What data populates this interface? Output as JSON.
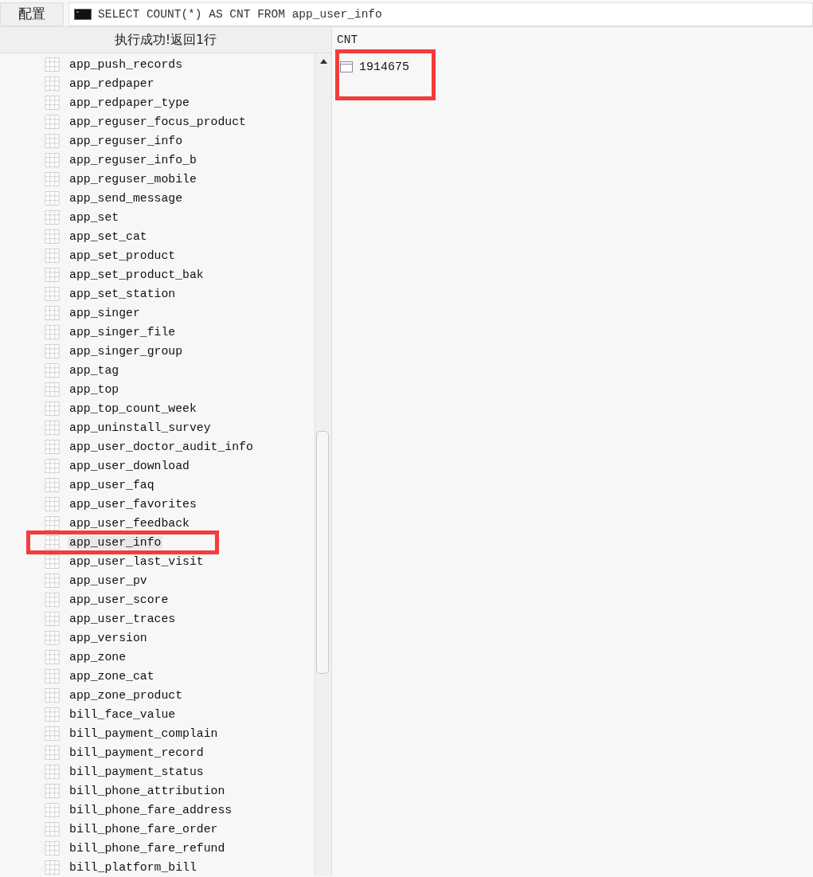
{
  "toolbar": {
    "config_label": "配置",
    "query": "SELECT COUNT(*) AS CNT FROM app_user_info"
  },
  "status": "执行成功!返回1行",
  "tables": [
    {
      "name": "app_push_records",
      "selected": false,
      "highlighted": false
    },
    {
      "name": "app_redpaper",
      "selected": false,
      "highlighted": false
    },
    {
      "name": "app_redpaper_type",
      "selected": false,
      "highlighted": false
    },
    {
      "name": "app_reguser_focus_product",
      "selected": false,
      "highlighted": false
    },
    {
      "name": "app_reguser_info",
      "selected": false,
      "highlighted": false
    },
    {
      "name": "app_reguser_info_b",
      "selected": false,
      "highlighted": false
    },
    {
      "name": "app_reguser_mobile",
      "selected": false,
      "highlighted": false
    },
    {
      "name": "app_send_message",
      "selected": false,
      "highlighted": false
    },
    {
      "name": "app_set",
      "selected": false,
      "highlighted": false
    },
    {
      "name": "app_set_cat",
      "selected": false,
      "highlighted": false
    },
    {
      "name": "app_set_product",
      "selected": false,
      "highlighted": false
    },
    {
      "name": "app_set_product_bak",
      "selected": false,
      "highlighted": false
    },
    {
      "name": "app_set_station",
      "selected": false,
      "highlighted": false
    },
    {
      "name": "app_singer",
      "selected": false,
      "highlighted": false
    },
    {
      "name": "app_singer_file",
      "selected": false,
      "highlighted": false
    },
    {
      "name": "app_singer_group",
      "selected": false,
      "highlighted": false
    },
    {
      "name": "app_tag",
      "selected": false,
      "highlighted": false
    },
    {
      "name": "app_top",
      "selected": false,
      "highlighted": false
    },
    {
      "name": "app_top_count_week",
      "selected": false,
      "highlighted": false
    },
    {
      "name": "app_uninstall_survey",
      "selected": false,
      "highlighted": false
    },
    {
      "name": "app_user_doctor_audit_info",
      "selected": false,
      "highlighted": false
    },
    {
      "name": "app_user_download",
      "selected": false,
      "highlighted": false
    },
    {
      "name": "app_user_faq",
      "selected": false,
      "highlighted": false
    },
    {
      "name": "app_user_favorites",
      "selected": false,
      "highlighted": false
    },
    {
      "name": "app_user_feedback",
      "selected": false,
      "highlighted": false
    },
    {
      "name": "app_user_info",
      "selected": true,
      "highlighted": true
    },
    {
      "name": "app_user_last_visit",
      "selected": false,
      "highlighted": false
    },
    {
      "name": "app_user_pv",
      "selected": false,
      "highlighted": false
    },
    {
      "name": "app_user_score",
      "selected": false,
      "highlighted": false
    },
    {
      "name": "app_user_traces",
      "selected": false,
      "highlighted": false
    },
    {
      "name": "app_version",
      "selected": false,
      "highlighted": false
    },
    {
      "name": "app_zone",
      "selected": false,
      "highlighted": false
    },
    {
      "name": "app_zone_cat",
      "selected": false,
      "highlighted": false
    },
    {
      "name": "app_zone_product",
      "selected": false,
      "highlighted": false
    },
    {
      "name": "bill_face_value",
      "selected": false,
      "highlighted": false
    },
    {
      "name": "bill_payment_complain",
      "selected": false,
      "highlighted": false
    },
    {
      "name": "bill_payment_record",
      "selected": false,
      "highlighted": false
    },
    {
      "name": "bill_payment_status",
      "selected": false,
      "highlighted": false
    },
    {
      "name": "bill_phone_attribution",
      "selected": false,
      "highlighted": false
    },
    {
      "name": "bill_phone_fare_address",
      "selected": false,
      "highlighted": false
    },
    {
      "name": "bill_phone_fare_order",
      "selected": false,
      "highlighted": false
    },
    {
      "name": "bill_phone_fare_refund",
      "selected": false,
      "highlighted": false
    },
    {
      "name": "bill_platform_bill",
      "selected": false,
      "highlighted": false
    }
  ],
  "result": {
    "columns": [
      "CNT"
    ],
    "rows": [
      {
        "cells": [
          "1914675"
        ],
        "highlighted": true
      }
    ]
  }
}
